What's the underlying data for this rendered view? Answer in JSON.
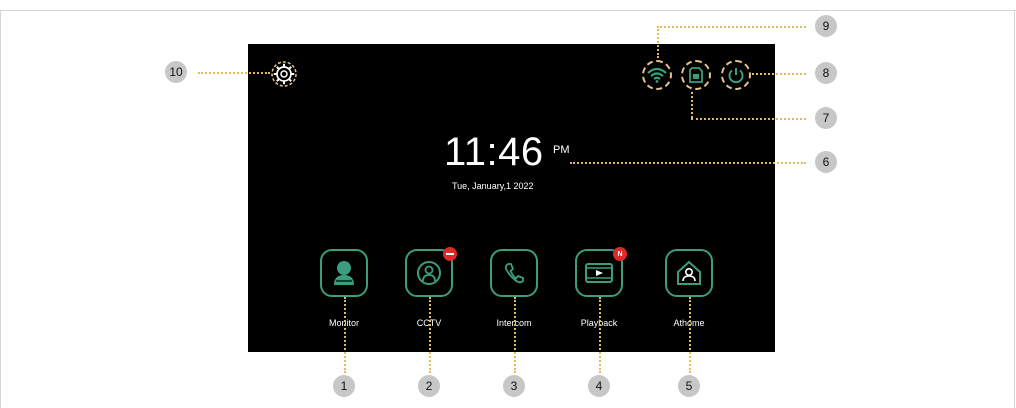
{
  "screen": {
    "time": "11:46",
    "ampm": "PM",
    "date": "Tue, January,1 2022"
  },
  "tiles": [
    {
      "label": "Monitor",
      "icon": "person-icon",
      "callout": "1"
    },
    {
      "label": "CCTV",
      "icon": "camera-person-icon",
      "callout": "2",
      "badge": ""
    },
    {
      "label": "Intercom",
      "icon": "phone-icon",
      "callout": "3"
    },
    {
      "label": "Playback",
      "icon": "video-play-icon",
      "callout": "4",
      "badge": "N"
    },
    {
      "label": "Athome",
      "icon": "home-person-icon",
      "callout": "5"
    }
  ],
  "callouts": {
    "clock": "6",
    "sd_card": "7",
    "power": "8",
    "wifi": "9",
    "settings": "10"
  },
  "colors": {
    "accent": "#3a9e7e",
    "dashed": "#e6b95c",
    "badge": "#e02828",
    "screen": "#000000",
    "callout_bg": "#c7c7c7"
  },
  "icons": {
    "settings": "gear-icon",
    "wifi": "wifi-icon",
    "sd_card": "sd-card-icon",
    "power": "power-icon"
  }
}
